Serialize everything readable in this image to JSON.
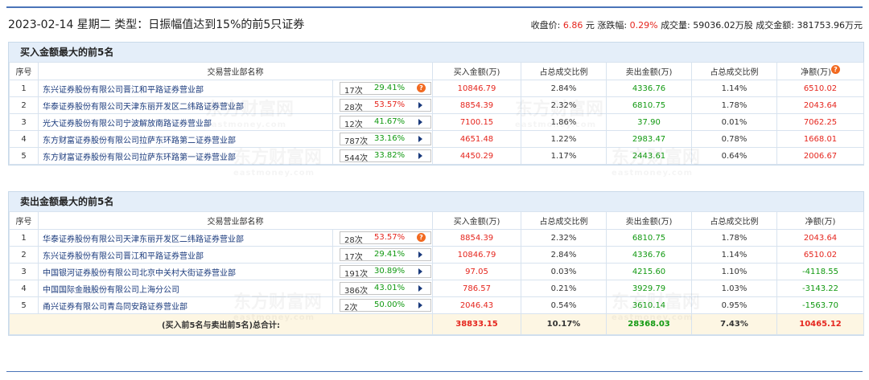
{
  "header": {
    "title": "2023-02-14 星期二 类型：日振幅值达到15%的前5只证券",
    "close_label": "收盘价:",
    "close_value": "6.86",
    "close_unit": "元",
    "change_label": "涨跌幅:",
    "change_value": "0.29%",
    "volume_label": "成交量:",
    "volume_value": "59036.02万股",
    "amount_label": "成交金额:",
    "amount_value": "381753.96万元"
  },
  "columns": {
    "seq": "序号",
    "name": "交易营业部名称",
    "buy": "买入金额(万)",
    "buy_ratio": "占总成交比例",
    "sell": "卖出金额(万)",
    "sell_ratio": "占总成交比例",
    "net": "净额(万)"
  },
  "buy_section": {
    "title": "买入金额最大的前5名",
    "rows": [
      {
        "seq": "1",
        "name": "东兴证券股份有限公司晋江和平路证券营业部",
        "times": "17次",
        "pct": "29.41%",
        "pct_up": false,
        "icon": "bubble-icon",
        "buy": "10846.79",
        "buy_ratio": "2.84%",
        "sell": "4336.76",
        "sell_ratio": "1.14%",
        "net": "6510.02",
        "net_up": true
      },
      {
        "seq": "2",
        "name": "华泰证券股份有限公司天津东丽开发区二纬路证券营业部",
        "times": "28次",
        "pct": "53.57%",
        "pct_up": true,
        "icon": "arrow-right-icon",
        "buy": "8854.39",
        "buy_ratio": "2.32%",
        "sell": "6810.75",
        "sell_ratio": "1.78%",
        "net": "2043.64",
        "net_up": true
      },
      {
        "seq": "3",
        "name": "光大证券股份有限公司宁波解放南路证券营业部",
        "times": "12次",
        "pct": "41.67%",
        "pct_up": false,
        "icon": "arrow-right-icon",
        "buy": "7100.15",
        "buy_ratio": "1.86%",
        "sell": "37.90",
        "sell_ratio": "0.01%",
        "net": "7062.25",
        "net_up": true
      },
      {
        "seq": "4",
        "name": "东方财富证券股份有限公司拉萨东环路第二证券营业部",
        "times": "787次",
        "pct": "33.16%",
        "pct_up": false,
        "icon": "arrow-right-icon",
        "buy": "4651.48",
        "buy_ratio": "1.22%",
        "sell": "2983.47",
        "sell_ratio": "0.78%",
        "net": "1668.01",
        "net_up": true
      },
      {
        "seq": "5",
        "name": "东方财富证券股份有限公司拉萨东环路第一证券营业部",
        "times": "544次",
        "pct": "33.82%",
        "pct_up": false,
        "icon": "arrow-right-icon",
        "buy": "4450.29",
        "buy_ratio": "1.17%",
        "sell": "2443.61",
        "sell_ratio": "0.64%",
        "net": "2006.67",
        "net_up": true
      }
    ]
  },
  "sell_section": {
    "title": "卖出金额最大的前5名",
    "rows": [
      {
        "seq": "1",
        "name": "华泰证券股份有限公司天津东丽开发区二纬路证券营业部",
        "times": "28次",
        "pct": "53.57%",
        "pct_up": true,
        "icon": "bubble-icon",
        "buy": "8854.39",
        "buy_ratio": "2.32%",
        "sell": "6810.75",
        "sell_ratio": "1.78%",
        "net": "2043.64",
        "net_up": true
      },
      {
        "seq": "2",
        "name": "东兴证券股份有限公司晋江和平路证券营业部",
        "times": "17次",
        "pct": "29.41%",
        "pct_up": false,
        "icon": "arrow-right-icon",
        "buy": "10846.79",
        "buy_ratio": "2.84%",
        "sell": "4336.76",
        "sell_ratio": "1.14%",
        "net": "6510.02",
        "net_up": true
      },
      {
        "seq": "3",
        "name": "中国银河证券股份有限公司北京中关村大街证券营业部",
        "times": "191次",
        "pct": "30.89%",
        "pct_up": false,
        "icon": "arrow-right-icon",
        "buy": "97.05",
        "buy_ratio": "0.03%",
        "sell": "4215.60",
        "sell_ratio": "1.10%",
        "net": "-4118.55",
        "net_up": false
      },
      {
        "seq": "4",
        "name": "中国国际金融股份有限公司上海分公司",
        "times": "386次",
        "pct": "43.01%",
        "pct_up": false,
        "icon": "arrow-right-icon",
        "buy": "786.57",
        "buy_ratio": "0.21%",
        "sell": "3929.79",
        "sell_ratio": "1.03%",
        "net": "-3143.22",
        "net_up": false
      },
      {
        "seq": "5",
        "name": "甬兴证券有限公司青岛同安路证券营业部",
        "times": "2次",
        "pct": "50.00%",
        "pct_up": false,
        "icon": "arrow-right-icon",
        "buy": "2046.43",
        "buy_ratio": "0.54%",
        "sell": "3610.14",
        "sell_ratio": "0.95%",
        "net": "-1563.70",
        "net_up": false
      }
    ],
    "total": {
      "label": "(买入前5名与卖出前5名)总合计:",
      "buy": "38833.15",
      "buy_ratio": "10.17%",
      "sell": "28368.03",
      "sell_ratio": "7.43%",
      "net": "10465.12"
    }
  },
  "watermark": {
    "big": "东方财富网",
    "small": "eastmoney.com"
  },
  "colors": {
    "up": "#e5261e",
    "down": "#119911",
    "link": "#1a3a7c",
    "section_bg": "#e4eef9",
    "total_bg": "#fdf6e3"
  }
}
